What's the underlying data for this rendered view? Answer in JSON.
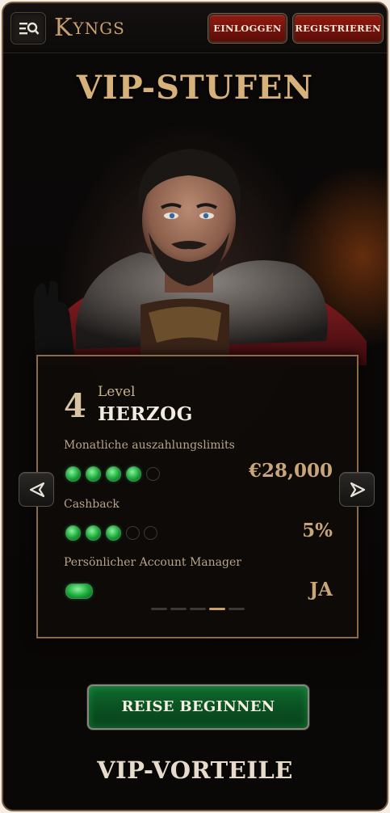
{
  "header": {
    "logo_text_first": "K",
    "logo_text_rest": "YNGS",
    "login_label": "EINLOGGEN",
    "register_label": "REGISTRIEREN",
    "menu_icon": "menu-search-icon"
  },
  "hero": {
    "title": "VIP-STUFEN",
    "portrait": "royal-man-portrait"
  },
  "card": {
    "level_number": "4",
    "level_label": "Level",
    "level_name": "HERZOG",
    "rows": [
      {
        "label": "Monatliche auszahlungslimits",
        "value": "€28,000",
        "filled": 4,
        "total": 5
      },
      {
        "label": "Cashback",
        "value": "5%",
        "filled": 3,
        "total": 5
      },
      {
        "label": "Persönlicher Account Manager",
        "value": "JA",
        "filled": 1,
        "total": 1
      }
    ]
  },
  "carousel": {
    "prev_icon": "chevron-left-icon",
    "next_icon": "chevron-right-icon",
    "page_count": 5,
    "active_page": 4
  },
  "cta_label": "REISE BEGINNEN",
  "section_title": "VIP-VORTEILE",
  "colors": {
    "gold": "#d6b27a",
    "accent_red": "#8f1a10",
    "emerald": "#19a93a"
  }
}
